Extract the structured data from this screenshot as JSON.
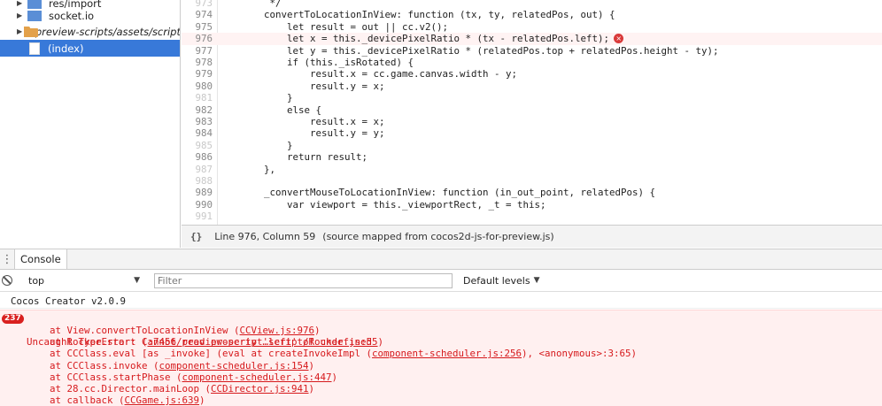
{
  "navigator": {
    "items": [
      {
        "label": "res/import",
        "type": "folder",
        "color": "#5a8ed6"
      },
      {
        "label": "socket.io",
        "type": "folder",
        "color": "#5a8ed6"
      },
      {
        "label": "preview-scripts/assets/script",
        "type": "folder",
        "color": "#e3a14a"
      },
      {
        "label": "(index)",
        "type": "file",
        "selected": true
      }
    ]
  },
  "editor": {
    "lines": [
      {
        "num": "973",
        "code": "     */"
      },
      {
        "num": "974",
        "code": "    convertToLocationInView: function (tx, ty, relatedPos, out) {"
      },
      {
        "num": "975",
        "code": "        let result = out || cc.v2();"
      },
      {
        "num": "976",
        "code": "        let x = this._devicePixelRatio * (tx - relatedPos.left);"
      },
      {
        "num": "977",
        "code": "        let y = this._devicePixelRatio * (relatedPos.top + relatedPos.height - ty);"
      },
      {
        "num": "978",
        "code": "        if (this._isRotated) {"
      },
      {
        "num": "979",
        "code": "            result.x = cc.game.canvas.width - y;"
      },
      {
        "num": "980",
        "code": "            result.y = x;"
      },
      {
        "num": "981",
        "code": "        }"
      },
      {
        "num": "982",
        "code": "        else {"
      },
      {
        "num": "983",
        "code": "            result.x = x;"
      },
      {
        "num": "984",
        "code": "            result.y = y;"
      },
      {
        "num": "985",
        "code": "        }"
      },
      {
        "num": "986",
        "code": "        return result;"
      },
      {
        "num": "987",
        "code": "    },"
      },
      {
        "num": "988",
        "code": ""
      },
      {
        "num": "989",
        "code": "    _convertMouseToLocationInView: function (in_out_point, relatedPos) {"
      },
      {
        "num": "990",
        "code": "        var viewport = this._viewportRect, _t = this;"
      },
      {
        "num": "991",
        "code": ""
      }
    ],
    "error_line": "976"
  },
  "statusbar": {
    "braces": "{}",
    "position": "Line 976, Column 59",
    "source_map": "(source mapped from cocos2d-js-for-preview.js)"
  },
  "drawer": {
    "menu_icon": "kebab-menu-icon",
    "tab_label": "Console"
  },
  "console_toolbar": {
    "context": "top",
    "filter_placeholder": "Filter",
    "levels": "Default levels"
  },
  "console": {
    "info": "Cocos Creator v2.0.9",
    "error_count": "237",
    "error_message": "Uncaught TypeError: Cannot read property 'left' of undefined",
    "stack": [
      {
        "prefix": "    at View.convertToLocationInView (",
        "link": "CCView.js:976",
        "suffix": ")"
      },
      {
        "prefix": "    at Rocker.start (",
        "link": ":7456/preview-script…script/Rocker.js:55",
        "suffix": ")"
      },
      {
        "prefix": "    at CCClass.eval [as _invoke] (eval at createInvokeImpl (",
        "link": "component-scheduler.js:256",
        "suffix": "), <anonymous>:3:65)"
      },
      {
        "prefix": "    at CCClass.invoke (",
        "link": "component-scheduler.js:154",
        "suffix": ")"
      },
      {
        "prefix": "    at CCClass.startPhase (",
        "link": "component-scheduler.js:447",
        "suffix": ")"
      },
      {
        "prefix": "    at 28.cc.Director.mainLoop (",
        "link": "CCDirector.js:941",
        "suffix": ")"
      },
      {
        "prefix": "    at callback (",
        "link": "CCGame.js:639",
        "suffix": ")"
      }
    ]
  }
}
